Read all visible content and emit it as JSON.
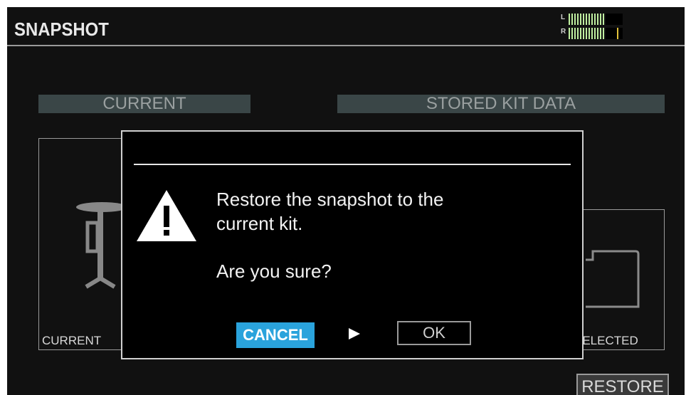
{
  "header": {
    "title": "SNAPSHOT",
    "meter": {
      "left_label": "L",
      "right_label": "R"
    }
  },
  "panels": {
    "current_header": "CURRENT",
    "stored_header": "STORED KIT DATA",
    "current_label": "CURRENT",
    "stored_label": "SELECTED"
  },
  "footer": {
    "restore_label": "RESTORE"
  },
  "dialog": {
    "message_line1": "Restore the snapshot to the",
    "message_line2": "current kit.",
    "question": "Are you sure?",
    "cancel_label": "CANCEL",
    "ok_label": "OK"
  },
  "colors": {
    "accent": "#2aa3dc",
    "background": "#111111",
    "meter_green": "#bfeea0",
    "meter_peak": "#e2c23a"
  }
}
